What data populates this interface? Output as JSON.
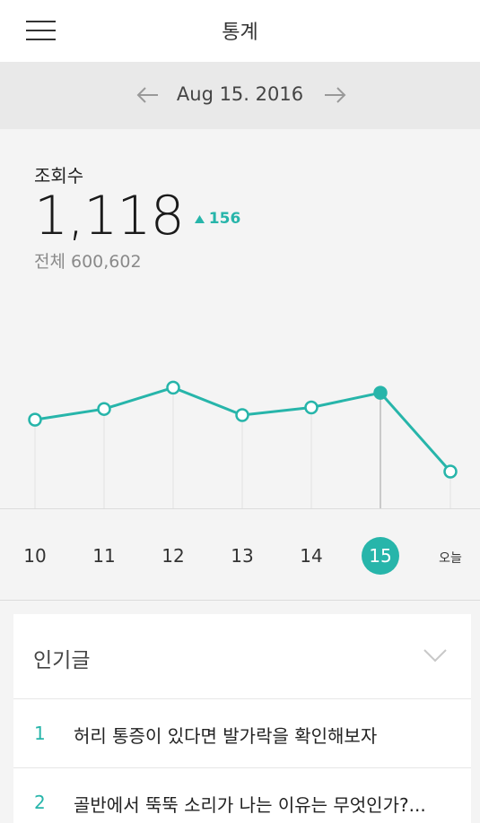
{
  "header": {
    "title": "통계",
    "menu_icon": "hamburger-menu-icon"
  },
  "date_nav": {
    "date": "Aug 15. 2016",
    "prev_icon": "arrow-left-icon",
    "next_icon": "arrow-right-icon"
  },
  "stats": {
    "label": "조회수",
    "value": "1,118",
    "delta": "156",
    "total": "전체 600,602",
    "accent_color": "#27b5aa"
  },
  "chart_data": {
    "type": "line",
    "categories": [
      "10",
      "11",
      "12",
      "13",
      "14",
      "15",
      "오늘"
    ],
    "values": [
      1030,
      1065,
      1135,
      1045,
      1070,
      1118,
      860
    ],
    "selected_index": 5,
    "line_color": "#27b5aa"
  },
  "popular": {
    "title": "인기글",
    "items": [
      {
        "rank": "1",
        "title": "허리 통증이 있다면 발가락을 확인해보자"
      },
      {
        "rank": "2",
        "title": "골반에서 뚝뚝 소리가 나는 이유는 무엇인가?..."
      }
    ]
  }
}
